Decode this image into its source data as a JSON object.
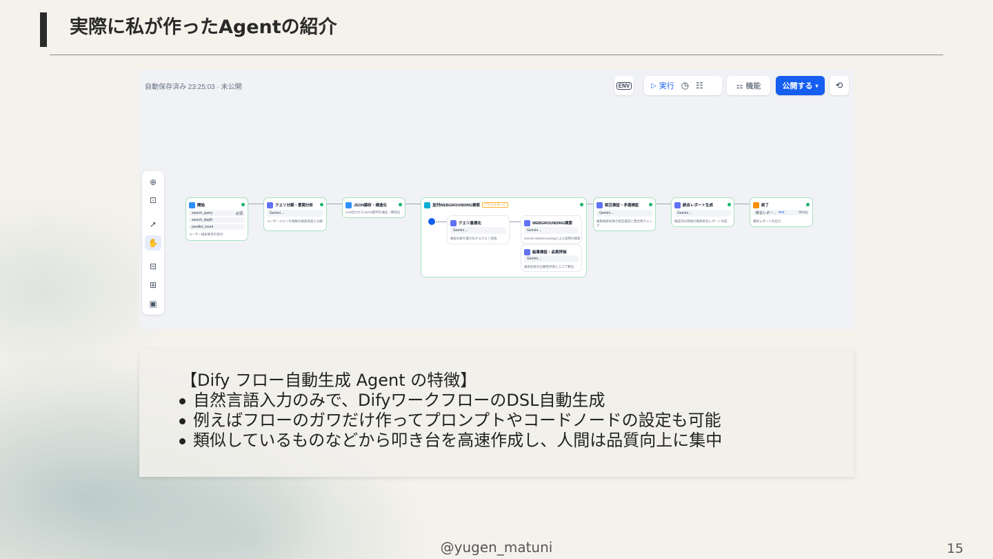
{
  "slide": {
    "title": "実際に私が作ったAgentの紹介",
    "footer": "@yugen_matuni",
    "page_number": "15"
  },
  "screenshot": {
    "autosave_status": "自動保存済み 23:25:03 · 未公開",
    "toolbar": {
      "env_label": "ENV",
      "run_label": "実行",
      "features_label": "機能",
      "publish_label": "公開する"
    },
    "left_tools": [
      "add-node",
      "add-note",
      "pointer",
      "hand",
      "export-image",
      "organize",
      "minimap"
    ],
    "nodes": {
      "start": {
        "title": "開始",
        "vars": [
          "search_query",
          "search_depth",
          "parallel_count"
        ],
        "var_flags": [
          "必須",
          "",
          ""
        ],
        "desc": "ユーザー検索要求の受付"
      },
      "query_analysis": {
        "title": "クエリ分解・意図分析",
        "model": "Gemini ...",
        "desc": "ユーザークエリを複数の検索角度に分解"
      },
      "json_parse": {
        "title": "JSON解析・構造化",
        "desc": "LLM出力からJSON配列を抽出・構造化"
      },
      "parallel_search": {
        "title": "並列WEBGROUNDING検索",
        "tag": "パラレルモード",
        "children": {
          "query_opt": {
            "title": "クエリ最適化",
            "model": "Gemini ...",
            "desc": "検索効果を最大化するクエリ変換"
          },
          "grounding": {
            "title": "WEBGROUNDING検索",
            "model": "Gemini ...",
            "desc": "Gemini WebGroundingによる実際の検索"
          },
          "eval": {
            "title": "結果検証・品質評価",
            "model": "Gemini ...",
            "desc": "検索結果の信頼性評価とスコア算出"
          }
        }
      },
      "cross_check": {
        "title": "相互検証・矛盾検証",
        "model": "Gemini ...",
        "desc": "複数検索結果の相互検証と整合性チェック"
      },
      "report": {
        "title": "統合レポート生成",
        "model": "Gemini ...",
        "desc": "検証済み情報の最終統合レポート作成"
      },
      "end": {
        "title": "終了",
        "var": "統合レポー...",
        "var_ref": "text",
        "var_type": "String",
        "desc": "最終レポートの出力"
      }
    }
  },
  "features": {
    "heading": "【Dify フロー自動生成 Agent の特徴】",
    "items": [
      "自然言語入力のみで、DifyワークフローのDSL自動生成",
      "例えばフローのガワだけ作ってプロンプトやコードノードの設定も可能",
      "類似しているものなどから叩き台を高速作成し、人間は品質向上に集中"
    ]
  }
}
